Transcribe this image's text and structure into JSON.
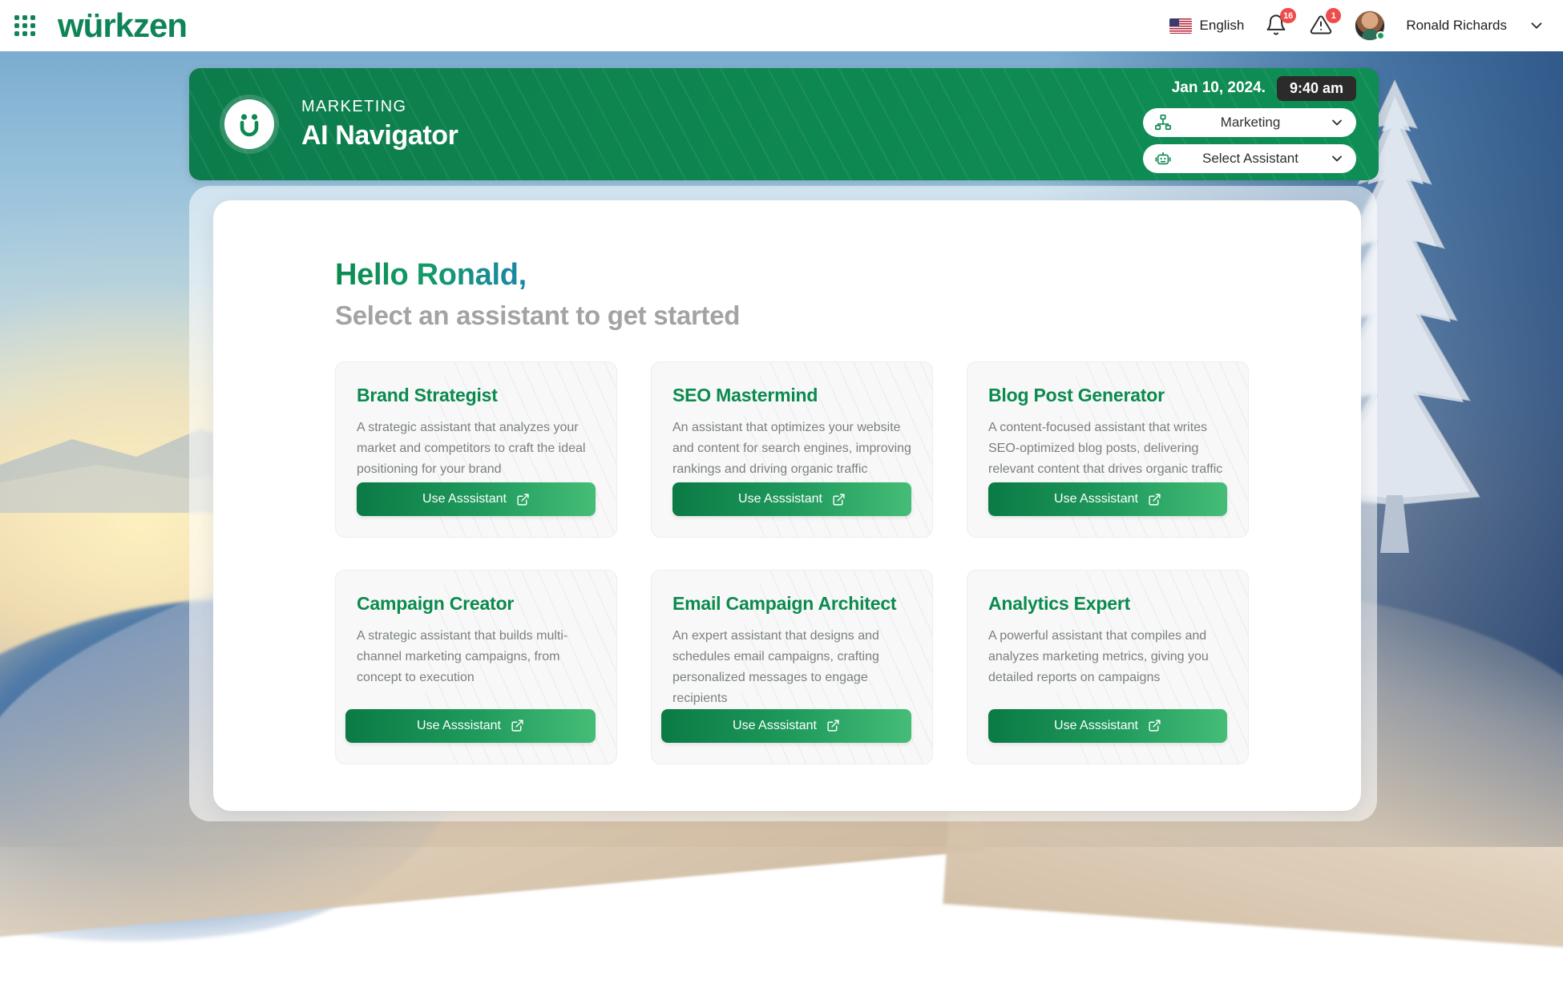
{
  "topbar": {
    "apps_icon": "grid-apps-icon",
    "brand": "würkzen",
    "language": "English",
    "flag_icon": "us-flag-icon",
    "notifications": {
      "icon": "bell-icon",
      "count": "16"
    },
    "alerts": {
      "icon": "warning-triangle-icon",
      "count": "1"
    },
    "user": {
      "name": "Ronald Richards",
      "avatar_icon": "avatar",
      "status": "online",
      "chevron_icon": "chevron-down-icon"
    }
  },
  "banner": {
    "logo_icon": "wurkzen-smiley-logo",
    "kicker": "MARKETING",
    "title": "AI Navigator",
    "date": "Jan 10, 2024.",
    "time": "9:40 am",
    "department_select": {
      "icon": "org-chart-icon",
      "value": "Marketing",
      "chevron_icon": "chevron-down-icon"
    },
    "assistant_select": {
      "icon": "robot-icon",
      "value": "Select Assistant",
      "chevron_icon": "chevron-down-icon"
    }
  },
  "main": {
    "hello": "Hello Ronald,",
    "subtitle": "Select an assistant to get started",
    "cards": [
      {
        "title": "Brand Strategist",
        "description": "A strategic assistant that analyzes your market and competitors to craft the ideal positioning for your brand",
        "button": "Use Asssistant"
      },
      {
        "title": "SEO Mastermind",
        "description": "An assistant that optimizes your website and content for search engines, improving rankings and driving organic traffic",
        "button": "Use Asssistant"
      },
      {
        "title": "Blog Post Generator",
        "description": "A content-focused assistant that writes SEO-optimized blog posts, delivering relevant content that drives organic traffic",
        "button": "Use Asssistant"
      },
      {
        "title": "Campaign Creator",
        "description": "A strategic assistant that builds multi-channel marketing campaigns, from concept to execution",
        "button": "Use Asssistant"
      },
      {
        "title": "Email Campaign Architect",
        "description": "An expert assistant that designs and schedules email campaigns, crafting personalized messages to engage recipients",
        "button": "Use Asssistant"
      },
      {
        "title": "Analytics Expert",
        "description": "A powerful assistant that compiles and analyzes marketing metrics, giving you detailed reports on campaigns",
        "button": "Use Asssistant"
      }
    ],
    "button_icon": "external-link-icon"
  },
  "colors": {
    "brand_green": "#0f8457",
    "banner_green": "#0e8851",
    "badge_red": "#ef4b4b",
    "time_pill": "#2b2b2b",
    "card_bg": "#f7f8f7",
    "muted_text": "#7b7f83"
  }
}
